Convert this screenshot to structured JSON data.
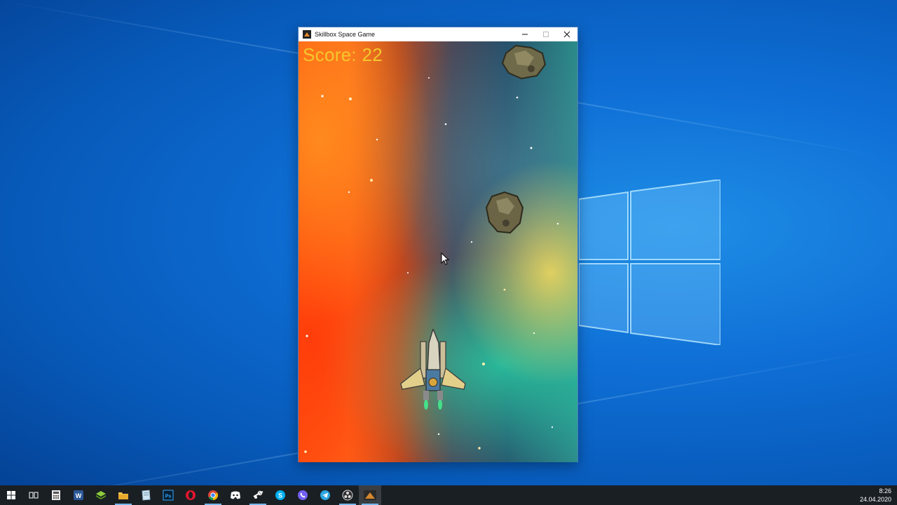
{
  "window": {
    "title": "Skillbox Space Game"
  },
  "game": {
    "score_text": "Score: 22"
  },
  "taskbar": {
    "items": [
      {
        "icon": "windows-start-icon"
      },
      {
        "icon": "task-view-icon"
      },
      {
        "icon": "calculator-icon"
      },
      {
        "icon": "word-icon"
      },
      {
        "icon": "stack-icon"
      },
      {
        "icon": "file-explorer-icon"
      },
      {
        "icon": "notepad-icon"
      },
      {
        "icon": "photoshop-icon"
      },
      {
        "icon": "opera-icon"
      },
      {
        "icon": "chrome-icon"
      },
      {
        "icon": "discord-icon"
      },
      {
        "icon": "steam-icon"
      },
      {
        "icon": "skype-icon"
      },
      {
        "icon": "viber-icon"
      },
      {
        "icon": "telegram-icon"
      },
      {
        "icon": "obs-icon"
      },
      {
        "icon": "space-game-icon"
      }
    ],
    "time": "8:26",
    "date": "24.04.2020"
  },
  "colors": {
    "score": "#f4c72c",
    "taskbar": "#1a1f24",
    "desktop": "#0f6fd6"
  }
}
